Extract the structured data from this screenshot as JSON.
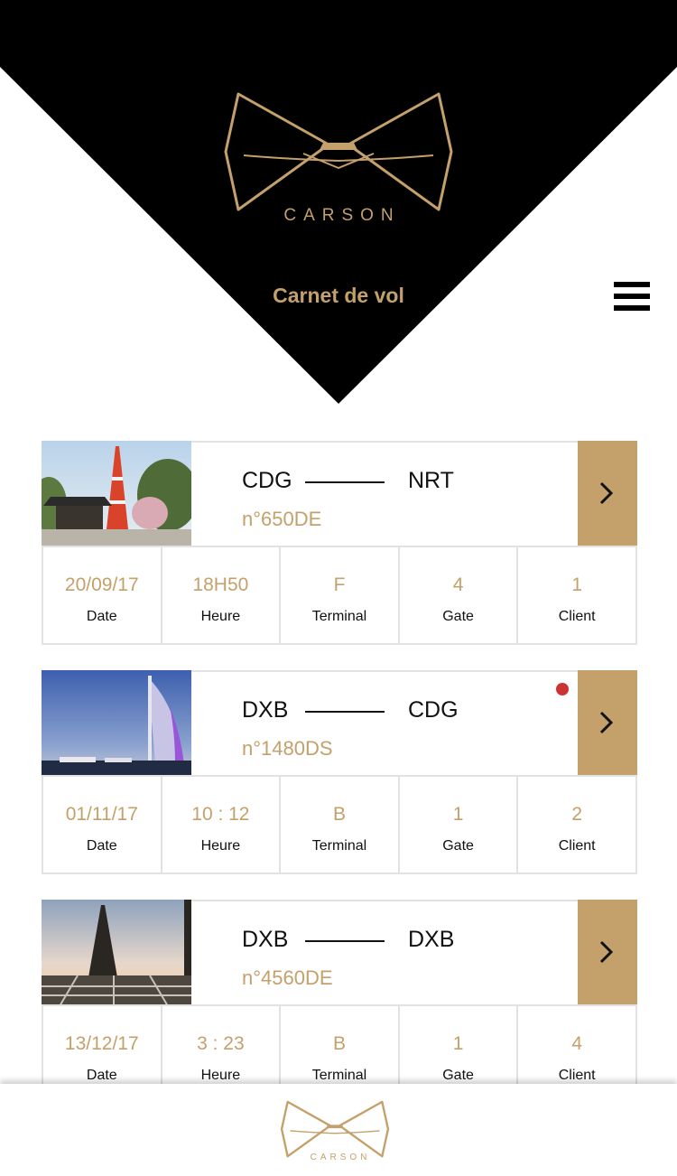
{
  "brand": {
    "name": "CARSON"
  },
  "header": {
    "title": "Carnet de vol"
  },
  "menu": {
    "icon": "hamburger-menu-icon"
  },
  "colors": {
    "gold": "#c4a06a",
    "black": "#000000",
    "alert": "#cc3333",
    "border": "#e2e2e2"
  },
  "flights": [
    {
      "from": "CDG",
      "to": "NRT",
      "number": "n°650DE",
      "image": "tokyo-tower-photo",
      "alert": false,
      "stats": [
        {
          "value": "20/09/17",
          "label": "Date"
        },
        {
          "value": "18H50",
          "label": "Heure"
        },
        {
          "value": "F",
          "label": "Terminal"
        },
        {
          "value": "4",
          "label": "Gate"
        },
        {
          "value": "1",
          "label": "Client"
        }
      ]
    },
    {
      "from": "DXB",
      "to": "CDG",
      "number": "n°1480DS",
      "image": "burj-al-arab-photo",
      "alert": true,
      "stats": [
        {
          "value": "01/11/17",
          "label": "Date"
        },
        {
          "value": "10 : 12",
          "label": "Heure"
        },
        {
          "value": "B",
          "label": "Terminal"
        },
        {
          "value": "1",
          "label": "Gate"
        },
        {
          "value": "2",
          "label": "Client"
        }
      ]
    },
    {
      "from": "DXB",
      "to": "DXB",
      "number": "n°4560DE",
      "image": "eiffel-tower-photo",
      "alert": false,
      "stats": [
        {
          "value": "13/12/17",
          "label": "Date"
        },
        {
          "value": "3 : 23",
          "label": "Heure"
        },
        {
          "value": "B",
          "label": "Terminal"
        },
        {
          "value": "1",
          "label": "Gate"
        },
        {
          "value": "4",
          "label": "Client"
        }
      ]
    }
  ],
  "footer": {
    "brand": "CARSON"
  }
}
